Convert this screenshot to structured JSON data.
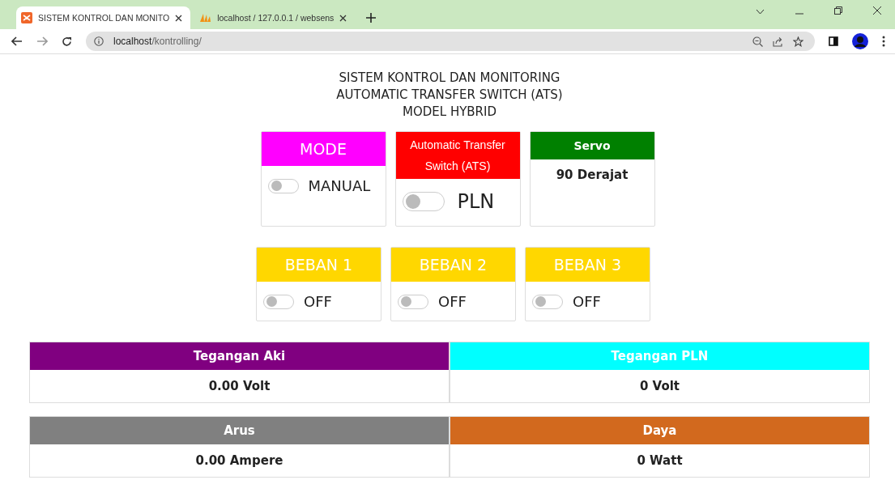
{
  "browser": {
    "tabs": [
      {
        "title": "SISTEM KONTROL DAN MONITO",
        "selected": true
      },
      {
        "title": "localhost / 127.0.0.1 / websens",
        "selected": false
      }
    ],
    "url_host": "localhost",
    "url_path": "/kontrolling/"
  },
  "heading": [
    "SISTEM KONTROL DAN MONITORING",
    "AUTOMATIC TRANSFER SWITCH (ATS)",
    "MODEL HYBRID"
  ],
  "control_cards": [
    {
      "kind": "switch",
      "title": "MODE",
      "color": "#ff00ff",
      "on": false,
      "state": "MANUAL"
    },
    {
      "kind": "switch",
      "title": "Automatic Transfer Switch (ATS)",
      "color": "#ff0000",
      "on": false,
      "state": "PLN"
    },
    {
      "kind": "reading",
      "title": "Servo",
      "color": "#008000",
      "value": "90 Derajat"
    }
  ],
  "load_cards": [
    {
      "title": "BEBAN 1",
      "color": "#ffd700",
      "on": false,
      "state": "OFF"
    },
    {
      "title": "BEBAN 2",
      "color": "#ffd700",
      "on": false,
      "state": "OFF"
    },
    {
      "title": "BEBAN 3",
      "color": "#ffd700",
      "on": false,
      "state": "OFF"
    }
  ],
  "meters": [
    {
      "title": "Tegangan Aki",
      "color": "#800080",
      "value": "0.00 Volt"
    },
    {
      "title": "Tegangan PLN",
      "color": "#00ffff",
      "value": "0 Volt"
    },
    {
      "title": "Arus",
      "color": "#808080",
      "value": "0.00 Ampere"
    },
    {
      "title": "Daya",
      "color": "#d2691e",
      "value": "0 Watt"
    }
  ]
}
